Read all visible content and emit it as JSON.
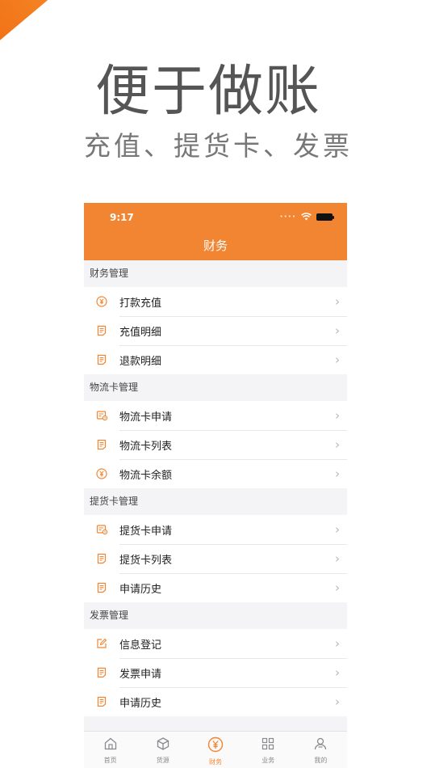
{
  "promo": {
    "headline": "便于做账",
    "subline": "充值、提货卡、发票"
  },
  "status_bar": {
    "time": "9:17"
  },
  "nav": {
    "title": "财务"
  },
  "sections": [
    {
      "title": "财务管理",
      "items": [
        {
          "label": "打款充值",
          "icon": "yen-circle-icon"
        },
        {
          "label": "充值明细",
          "icon": "document-list-icon"
        },
        {
          "label": "退款明细",
          "icon": "document-list-icon"
        }
      ]
    },
    {
      "title": "物流卡管理",
      "items": [
        {
          "label": "物流卡申请",
          "icon": "card-apply-icon"
        },
        {
          "label": "物流卡列表",
          "icon": "document-list-icon"
        },
        {
          "label": "物流卡余额",
          "icon": "yen-circle-icon"
        }
      ]
    },
    {
      "title": "提货卡管理",
      "items": [
        {
          "label": "提货卡申请",
          "icon": "card-apply-icon"
        },
        {
          "label": "提货卡列表",
          "icon": "document-list-icon"
        },
        {
          "label": "申请历史",
          "icon": "document-list-icon"
        }
      ]
    },
    {
      "title": "发票管理",
      "items": [
        {
          "label": "信息登记",
          "icon": "edit-icon"
        },
        {
          "label": "发票申请",
          "icon": "document-list-icon"
        },
        {
          "label": "申请历史",
          "icon": "document-list-icon"
        }
      ]
    }
  ],
  "tabs": [
    {
      "label": "首页",
      "icon": "home-icon",
      "active": false
    },
    {
      "label": "货源",
      "icon": "cube-icon",
      "active": false
    },
    {
      "label": "财务",
      "icon": "yen-circle-icon",
      "active": true
    },
    {
      "label": "业务",
      "icon": "grid-icon",
      "active": false
    },
    {
      "label": "我的",
      "icon": "user-icon",
      "active": false
    }
  ],
  "colors": {
    "accent": "#f28532",
    "ribbon": "#f06a10"
  }
}
